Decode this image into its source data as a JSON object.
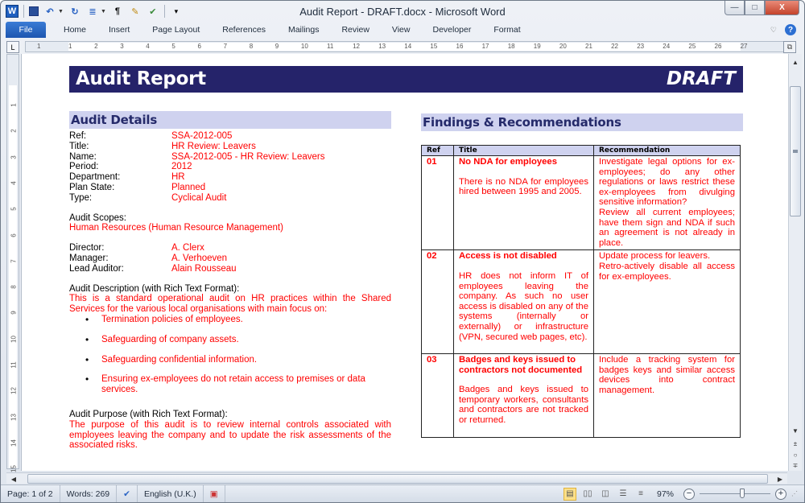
{
  "window": {
    "title": "Audit Report - DRAFT.docx - Microsoft Word",
    "controls": {
      "minimize": "—",
      "restore": "□",
      "close": "X"
    }
  },
  "quick_access": [
    {
      "name": "word-logo-icon",
      "glyph": "W"
    },
    {
      "name": "save-icon",
      "glyph": ""
    },
    {
      "name": "undo-icon",
      "glyph": "↶"
    },
    {
      "name": "redo-icon",
      "glyph": "↻"
    },
    {
      "name": "numbering-icon",
      "glyph": "≣"
    },
    {
      "name": "pilcrow-icon",
      "glyph": "¶"
    },
    {
      "name": "highlight-icon",
      "glyph": "✎"
    },
    {
      "name": "spellcheck-icon",
      "glyph": "✔"
    },
    {
      "name": "customize-icon",
      "glyph": "▾"
    }
  ],
  "ribbon": {
    "tabs": [
      "File",
      "Home",
      "Insert",
      "Page Layout",
      "References",
      "Mailings",
      "Review",
      "View",
      "Developer",
      "Format"
    ],
    "minimize_glyph": "♡",
    "help_glyph": "?"
  },
  "ruler": {
    "horizontal": [
      "1",
      "1",
      "2",
      "3",
      "4",
      "5",
      "6",
      "7",
      "8",
      "9",
      "10",
      "11",
      "12",
      "13",
      "14",
      "15",
      "16",
      "17",
      "18",
      "19",
      "20",
      "21",
      "22",
      "23",
      "24",
      "25",
      "26",
      "27"
    ],
    "vertical": [
      "1",
      "2",
      "3",
      "4",
      "5",
      "6",
      "7",
      "8",
      "9",
      "10",
      "11",
      "12",
      "13",
      "14",
      "15"
    ],
    "corner_glyph": "L"
  },
  "document": {
    "banner_title": "Audit Report",
    "banner_status": "DRAFT",
    "details_heading": "Audit Details",
    "details": [
      {
        "key": "Ref:",
        "value": "SSA-2012-005"
      },
      {
        "key": "Title:",
        "value": "HR Review: Leavers"
      },
      {
        "key": "Name:",
        "value": "SSA-2012-005 - HR Review: Leavers"
      },
      {
        "key": "Period:",
        "value": "2012"
      },
      {
        "key": "Department:",
        "value": "HR"
      },
      {
        "key": "Plan State:",
        "value": "Planned"
      },
      {
        "key": "Type:",
        "value": "Cyclical Audit"
      }
    ],
    "scopes_label": "Audit Scopes:",
    "scopes_value": "Human Resources (Human Resource Management)",
    "people": [
      {
        "key": "Director:",
        "value": "A. Clerx"
      },
      {
        "key": "Manager:",
        "value": "A. Verhoeven"
      },
      {
        "key": "Lead Auditor:",
        "value": "Alain Rousseau"
      }
    ],
    "description_label": "Audit Description (with Rich Text Format):",
    "description_text": "This is a standard operational audit on HR practices within the Shared Services for the various local organisations with main focus on:",
    "description_bullets": [
      "Termination policies of employees.",
      "Safeguarding of company assets.",
      "Safeguarding confidential information.",
      "Ensuring ex-employees do not retain access to premises or data services."
    ],
    "purpose_label": "Audit Purpose (with Rich Text Format):",
    "purpose_text": "The purpose of this audit is to review internal controls associated with employees leaving the company and to update the risk assessments of the associated risks.",
    "findings_heading": "Findings & Recommendations",
    "findings_columns": [
      "Ref",
      "Title",
      "Recommendation"
    ],
    "findings": [
      {
        "ref": "01",
        "title": "No NDA for employees",
        "description": "There is no NDA for employees hired between 1995 and 2005.",
        "recommendation": [
          "Investigate legal options for ex-employees; do any other regulations or laws restrict these ex-employees from divulging sensitive information?",
          "Review all current employees; have them sign and NDA if such an agreement is not already in place."
        ]
      },
      {
        "ref": "02",
        "title": "Access is not disabled",
        "description": "HR does not inform IT of employees leaving the company. As such no user access is disabled on any of the systems (internally or externally) or infrastructure (VPN, secured web pages, etc).",
        "recommendation": [
          "Update process for leavers.",
          "Retro-actively disable all access for ex-employees."
        ]
      },
      {
        "ref": "03",
        "title": "Badges and keys issued to contractors not documented",
        "description": "Badges and keys issued to temporary workers, consultants and contractors are not tracked or returned.",
        "recommendation": [
          "Include a tracking system for badges keys and similar access devices into contract management."
        ]
      }
    ]
  },
  "statusbar": {
    "page": "Page: 1 of 2",
    "words": "Words: 269",
    "language": "English (U.K.)",
    "zoom": "97%",
    "zoom_fraction": 0.6
  },
  "colors": {
    "banner": "#25236a",
    "heading_bg": "#cfd2ef",
    "heading_text": "#252a6a",
    "field_value": "#ff0000",
    "file_tab": "#1d56b0"
  }
}
